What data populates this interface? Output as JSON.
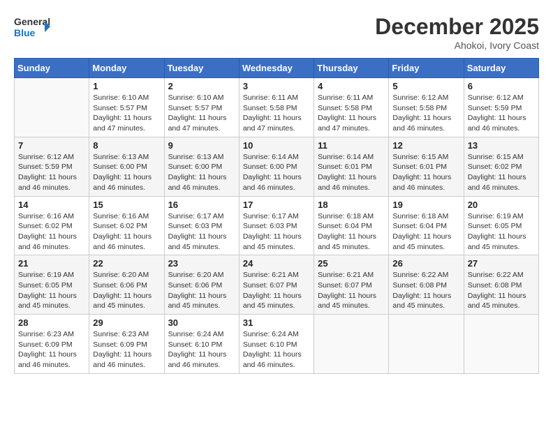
{
  "header": {
    "logo_line1": "General",
    "logo_line2": "Blue",
    "month": "December 2025",
    "location": "Ahokoi, Ivory Coast"
  },
  "weekdays": [
    "Sunday",
    "Monday",
    "Tuesday",
    "Wednesday",
    "Thursday",
    "Friday",
    "Saturday"
  ],
  "weeks": [
    [
      {
        "day": "",
        "info": ""
      },
      {
        "day": "1",
        "info": "Sunrise: 6:10 AM\nSunset: 5:57 PM\nDaylight: 11 hours\nand 47 minutes."
      },
      {
        "day": "2",
        "info": "Sunrise: 6:10 AM\nSunset: 5:57 PM\nDaylight: 11 hours\nand 47 minutes."
      },
      {
        "day": "3",
        "info": "Sunrise: 6:11 AM\nSunset: 5:58 PM\nDaylight: 11 hours\nand 47 minutes."
      },
      {
        "day": "4",
        "info": "Sunrise: 6:11 AM\nSunset: 5:58 PM\nDaylight: 11 hours\nand 47 minutes."
      },
      {
        "day": "5",
        "info": "Sunrise: 6:12 AM\nSunset: 5:58 PM\nDaylight: 11 hours\nand 46 minutes."
      },
      {
        "day": "6",
        "info": "Sunrise: 6:12 AM\nSunset: 5:59 PM\nDaylight: 11 hours\nand 46 minutes."
      }
    ],
    [
      {
        "day": "7",
        "info": "Sunrise: 6:12 AM\nSunset: 5:59 PM\nDaylight: 11 hours\nand 46 minutes."
      },
      {
        "day": "8",
        "info": "Sunrise: 6:13 AM\nSunset: 6:00 PM\nDaylight: 11 hours\nand 46 minutes."
      },
      {
        "day": "9",
        "info": "Sunrise: 6:13 AM\nSunset: 6:00 PM\nDaylight: 11 hours\nand 46 minutes."
      },
      {
        "day": "10",
        "info": "Sunrise: 6:14 AM\nSunset: 6:00 PM\nDaylight: 11 hours\nand 46 minutes."
      },
      {
        "day": "11",
        "info": "Sunrise: 6:14 AM\nSunset: 6:01 PM\nDaylight: 11 hours\nand 46 minutes."
      },
      {
        "day": "12",
        "info": "Sunrise: 6:15 AM\nSunset: 6:01 PM\nDaylight: 11 hours\nand 46 minutes."
      },
      {
        "day": "13",
        "info": "Sunrise: 6:15 AM\nSunset: 6:02 PM\nDaylight: 11 hours\nand 46 minutes."
      }
    ],
    [
      {
        "day": "14",
        "info": "Sunrise: 6:16 AM\nSunset: 6:02 PM\nDaylight: 11 hours\nand 46 minutes."
      },
      {
        "day": "15",
        "info": "Sunrise: 6:16 AM\nSunset: 6:02 PM\nDaylight: 11 hours\nand 46 minutes."
      },
      {
        "day": "16",
        "info": "Sunrise: 6:17 AM\nSunset: 6:03 PM\nDaylight: 11 hours\nand 45 minutes."
      },
      {
        "day": "17",
        "info": "Sunrise: 6:17 AM\nSunset: 6:03 PM\nDaylight: 11 hours\nand 45 minutes."
      },
      {
        "day": "18",
        "info": "Sunrise: 6:18 AM\nSunset: 6:04 PM\nDaylight: 11 hours\nand 45 minutes."
      },
      {
        "day": "19",
        "info": "Sunrise: 6:18 AM\nSunset: 6:04 PM\nDaylight: 11 hours\nand 45 minutes."
      },
      {
        "day": "20",
        "info": "Sunrise: 6:19 AM\nSunset: 6:05 PM\nDaylight: 11 hours\nand 45 minutes."
      }
    ],
    [
      {
        "day": "21",
        "info": "Sunrise: 6:19 AM\nSunset: 6:05 PM\nDaylight: 11 hours\nand 45 minutes."
      },
      {
        "day": "22",
        "info": "Sunrise: 6:20 AM\nSunset: 6:06 PM\nDaylight: 11 hours\nand 45 minutes."
      },
      {
        "day": "23",
        "info": "Sunrise: 6:20 AM\nSunset: 6:06 PM\nDaylight: 11 hours\nand 45 minutes."
      },
      {
        "day": "24",
        "info": "Sunrise: 6:21 AM\nSunset: 6:07 PM\nDaylight: 11 hours\nand 45 minutes."
      },
      {
        "day": "25",
        "info": "Sunrise: 6:21 AM\nSunset: 6:07 PM\nDaylight: 11 hours\nand 45 minutes."
      },
      {
        "day": "26",
        "info": "Sunrise: 6:22 AM\nSunset: 6:08 PM\nDaylight: 11 hours\nand 45 minutes."
      },
      {
        "day": "27",
        "info": "Sunrise: 6:22 AM\nSunset: 6:08 PM\nDaylight: 11 hours\nand 45 minutes."
      }
    ],
    [
      {
        "day": "28",
        "info": "Sunrise: 6:23 AM\nSunset: 6:09 PM\nDaylight: 11 hours\nand 46 minutes."
      },
      {
        "day": "29",
        "info": "Sunrise: 6:23 AM\nSunset: 6:09 PM\nDaylight: 11 hours\nand 46 minutes."
      },
      {
        "day": "30",
        "info": "Sunrise: 6:24 AM\nSunset: 6:10 PM\nDaylight: 11 hours\nand 46 minutes."
      },
      {
        "day": "31",
        "info": "Sunrise: 6:24 AM\nSunset: 6:10 PM\nDaylight: 11 hours\nand 46 minutes."
      },
      {
        "day": "",
        "info": ""
      },
      {
        "day": "",
        "info": ""
      },
      {
        "day": "",
        "info": ""
      }
    ]
  ]
}
